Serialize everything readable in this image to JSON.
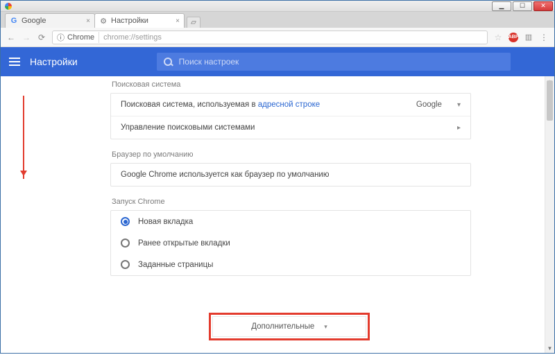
{
  "window": {
    "min": "▁",
    "max": "☐",
    "close": "✕"
  },
  "tabs": [
    {
      "title": "Google",
      "favicon": "G"
    },
    {
      "title": "Настройки",
      "favicon": "⚙"
    }
  ],
  "omnibox": {
    "scheme_label": "Chrome",
    "url": "chrome://settings"
  },
  "header": {
    "title": "Настройки",
    "search_placeholder": "Поиск настроек"
  },
  "sections": {
    "search_engine": {
      "title": "Поисковая система",
      "row1_prefix": "Поисковая система, используемая в ",
      "row1_link": "адресной строке",
      "row1_value": "Google",
      "row2": "Управление поисковыми системами"
    },
    "default_browser": {
      "title": "Браузер по умолчанию",
      "text": "Google Chrome используется как браузер по умолчанию"
    },
    "startup": {
      "title": "Запуск Chrome",
      "options": [
        "Новая вкладка",
        "Ранее открытые вкладки",
        "Заданные страницы"
      ],
      "selected_index": 0
    }
  },
  "footer_button": "Дополнительные",
  "colors": {
    "brand_blue": "#3367d6",
    "annotation_red": "#e33b2d"
  }
}
